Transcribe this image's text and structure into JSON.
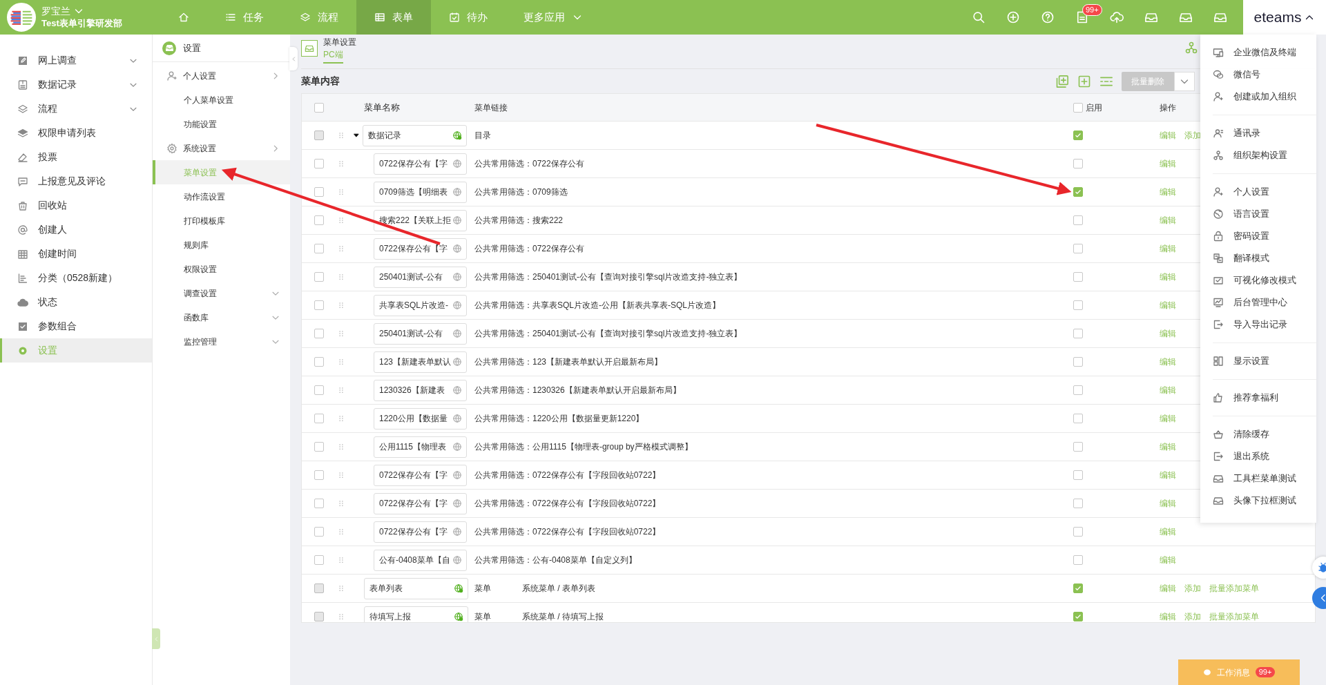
{
  "user": {
    "name": "罗宝兰",
    "dept": "Test表单引擎研发部"
  },
  "nav": [
    {
      "kind": "home",
      "selected": false
    },
    {
      "kind": "tasks",
      "label": "任务",
      "selected": false
    },
    {
      "kind": "flow",
      "label": "流程",
      "selected": false
    },
    {
      "kind": "form",
      "label": "表单",
      "selected": true
    },
    {
      "kind": "todo",
      "label": "待办",
      "selected": false
    },
    {
      "kind": "more",
      "label": "更多应用",
      "selected": false
    }
  ],
  "top_icons": [
    {
      "kind": "search"
    },
    {
      "kind": "add"
    },
    {
      "kind": "help"
    },
    {
      "kind": "notice",
      "badge": "99+"
    },
    {
      "kind": "cloud"
    },
    {
      "kind": "tray"
    },
    {
      "kind": "tray"
    },
    {
      "kind": "tray"
    }
  ],
  "brand": "eteams",
  "sidebar": {
    "items": [
      {
        "kind": "survey",
        "label": "网上调查",
        "expandable": true,
        "selected": false
      },
      {
        "kind": "record",
        "label": "数据记录",
        "expandable": true,
        "selected": false
      },
      {
        "kind": "flow",
        "label": "流程",
        "expandable": true,
        "selected": false
      },
      {
        "kind": "permission",
        "label": "权限申请列表",
        "expandable": false,
        "selected": false
      },
      {
        "kind": "vote",
        "label": "投票",
        "expandable": false,
        "selected": false
      },
      {
        "kind": "feedback",
        "label": "上报意见及评论",
        "expandable": false,
        "selected": false
      },
      {
        "kind": "trash",
        "label": "回收站",
        "expandable": false,
        "selected": false
      },
      {
        "kind": "creator",
        "label": "创建人",
        "expandable": false,
        "selected": false
      },
      {
        "kind": "time",
        "label": "创建时间",
        "expandable": false,
        "selected": false
      },
      {
        "kind": "category",
        "label": "分类（0528新建）",
        "expandable": false,
        "selected": false
      },
      {
        "kind": "status",
        "label": "状态",
        "expandable": false,
        "selected": false
      },
      {
        "kind": "params",
        "label": "参数组合",
        "expandable": false,
        "selected": false
      },
      {
        "kind": "settings",
        "label": "设置",
        "expandable": false,
        "selected": true
      }
    ]
  },
  "subnav": {
    "title": "设置",
    "items": [
      {
        "kind": "personal",
        "label": "个人设置",
        "selected": false
      },
      {
        "kind": "item",
        "label": "个人菜单设置",
        "selected": false
      },
      {
        "kind": "item",
        "label": "功能设置",
        "selected": false
      },
      {
        "kind": "system",
        "label": "系统设置",
        "selected": false
      },
      {
        "kind": "item",
        "label": "菜单设置",
        "selected": true
      },
      {
        "kind": "item",
        "label": "动作流设置",
        "selected": false
      },
      {
        "kind": "item",
        "label": "打印模板库",
        "selected": false
      },
      {
        "kind": "item",
        "label": "规则库",
        "selected": false
      },
      {
        "kind": "item",
        "label": "权限设置",
        "selected": false
      },
      {
        "kind": "collapsible",
        "label": "调查设置",
        "selected": false
      },
      {
        "kind": "collapsible",
        "label": "函数库",
        "selected": false
      },
      {
        "kind": "collapsible",
        "label": "监控管理",
        "selected": false
      }
    ]
  },
  "page": {
    "breadcrumb": "菜单设置",
    "tabs": [
      {
        "label": "PC端",
        "selected": true
      }
    ],
    "section": "菜单内容",
    "batch_delete": "批量删除"
  },
  "table": {
    "columns": [
      "菜单名称",
      "菜单链接",
      "启用",
      "操作"
    ],
    "select_all_checked": false,
    "enable_all_checked": false,
    "rows": [
      {
        "kind": "system",
        "name": "数据记录",
        "type": "目录",
        "enabled": true,
        "expanded": true,
        "actions": [
          "编辑",
          "添加"
        ],
        "children": [
          {
            "kind": "filter",
            "name": "0722保存公有【字",
            "link": "公共常用筛选：0722保存公有",
            "enabled": false,
            "actions": [
              "编辑"
            ]
          },
          {
            "kind": "filter",
            "name": "0709筛选【明细表",
            "link": "公共常用筛选：0709筛选",
            "enabled": true,
            "actions": [
              "编辑"
            ]
          },
          {
            "kind": "filter",
            "name": "搜索222【关联上拒",
            "link": "公共常用筛选：搜索222",
            "enabled": false,
            "actions": [
              "编辑"
            ]
          },
          {
            "kind": "filter",
            "name": "0722保存公有【字",
            "link": "公共常用筛选：0722保存公有",
            "enabled": false,
            "actions": [
              "编辑"
            ]
          },
          {
            "kind": "filter",
            "name": "250401测试-公有",
            "link": "公共常用筛选：250401测试-公有【查询对接引擎sql片改造支持-独立表】",
            "enabled": false,
            "actions": [
              "编辑"
            ]
          },
          {
            "kind": "filter",
            "name": "共享表SQL片改造-",
            "link": "公共常用筛选：共享表SQL片改造-公用【新表共享表-SQL片改造】",
            "enabled": false,
            "actions": [
              "编辑"
            ]
          },
          {
            "kind": "filter",
            "name": "250401测试-公有",
            "link": "公共常用筛选：250401测试-公有【查询对接引擎sql片改造支持-独立表】",
            "enabled": false,
            "actions": [
              "编辑"
            ]
          },
          {
            "kind": "filter",
            "name": "123【新建表单默认",
            "link": "公共常用筛选：123【新建表单默认开启最新布局】",
            "enabled": false,
            "actions": [
              "编辑"
            ]
          },
          {
            "kind": "filter",
            "name": "1230326【新建表",
            "link": "公共常用筛选：1230326【新建表单默认开启最新布局】",
            "enabled": false,
            "actions": [
              "编辑"
            ]
          },
          {
            "kind": "filter",
            "name": "1220公用【数据量",
            "link": "公共常用筛选：1220公用【数据量更新1220】",
            "enabled": false,
            "actions": [
              "编辑"
            ]
          },
          {
            "kind": "filter",
            "name": "公用1115【物理表",
            "link": "公共常用筛选：公用1115【物理表-group by严格模式调整】",
            "enabled": false,
            "actions": [
              "编辑"
            ]
          },
          {
            "kind": "filter",
            "name": "0722保存公有【字",
            "link": "公共常用筛选：0722保存公有【字段回收站0722】",
            "enabled": false,
            "actions": [
              "编辑"
            ]
          },
          {
            "kind": "filter",
            "name": "0722保存公有【字",
            "link": "公共常用筛选：0722保存公有【字段回收站0722】",
            "enabled": false,
            "actions": [
              "编辑"
            ]
          },
          {
            "kind": "filter",
            "name": "0722保存公有【字",
            "link": "公共常用筛选：0722保存公有【字段回收站0722】",
            "enabled": false,
            "actions": [
              "编辑"
            ]
          },
          {
            "kind": "filter",
            "name": "公有-0408菜单【自",
            "link": "公共常用筛选：公有-0408菜单【自定义列】",
            "enabled": false,
            "actions": [
              "编辑"
            ]
          }
        ]
      },
      {
        "kind": "system",
        "name": "表单列表",
        "type": "菜单",
        "link": "系统菜单 / 表单列表",
        "enabled": true,
        "actions": [
          "编辑",
          "添加",
          "批量添加菜单"
        ]
      },
      {
        "kind": "system",
        "name": "待填写上报",
        "type": "菜单",
        "link": "系统菜单 / 待填写上报",
        "enabled": true,
        "actions": [
          "编辑",
          "添加",
          "批量添加菜单"
        ]
      }
    ]
  },
  "dropdown": {
    "groups": [
      [
        {
          "kind": "monitor",
          "label": "企业微信及终端"
        },
        {
          "kind": "chat",
          "label": "微信号"
        },
        {
          "kind": "user",
          "label": "创建或加入组织"
        }
      ],
      [
        {
          "kind": "contacts",
          "label": "通讯录"
        },
        {
          "kind": "org",
          "label": "组织架构设置"
        }
      ],
      [
        {
          "kind": "user",
          "label": "个人设置"
        },
        {
          "kind": "globe",
          "label": "语言设置"
        },
        {
          "kind": "lock",
          "label": "密码设置"
        },
        {
          "kind": "translate",
          "label": "翻译模式"
        },
        {
          "kind": "visual",
          "label": "可视化修改模式"
        },
        {
          "kind": "dashboard",
          "label": "后台管理中心"
        },
        {
          "kind": "import",
          "label": "导入导出记录"
        }
      ],
      [
        {
          "kind": "layout",
          "label": "显示设置"
        }
      ],
      [
        {
          "kind": "thumb",
          "label": "推荐拿福利"
        }
      ],
      [
        {
          "kind": "basket",
          "label": "清除缓存"
        },
        {
          "kind": "logout",
          "label": "退出系统"
        },
        {
          "kind": "tray",
          "label": "工具栏菜单测试"
        },
        {
          "kind": "tray",
          "label": "头像下拉框测试"
        }
      ]
    ]
  },
  "work_messages": {
    "label": "工作消息",
    "badge": "99+"
  }
}
